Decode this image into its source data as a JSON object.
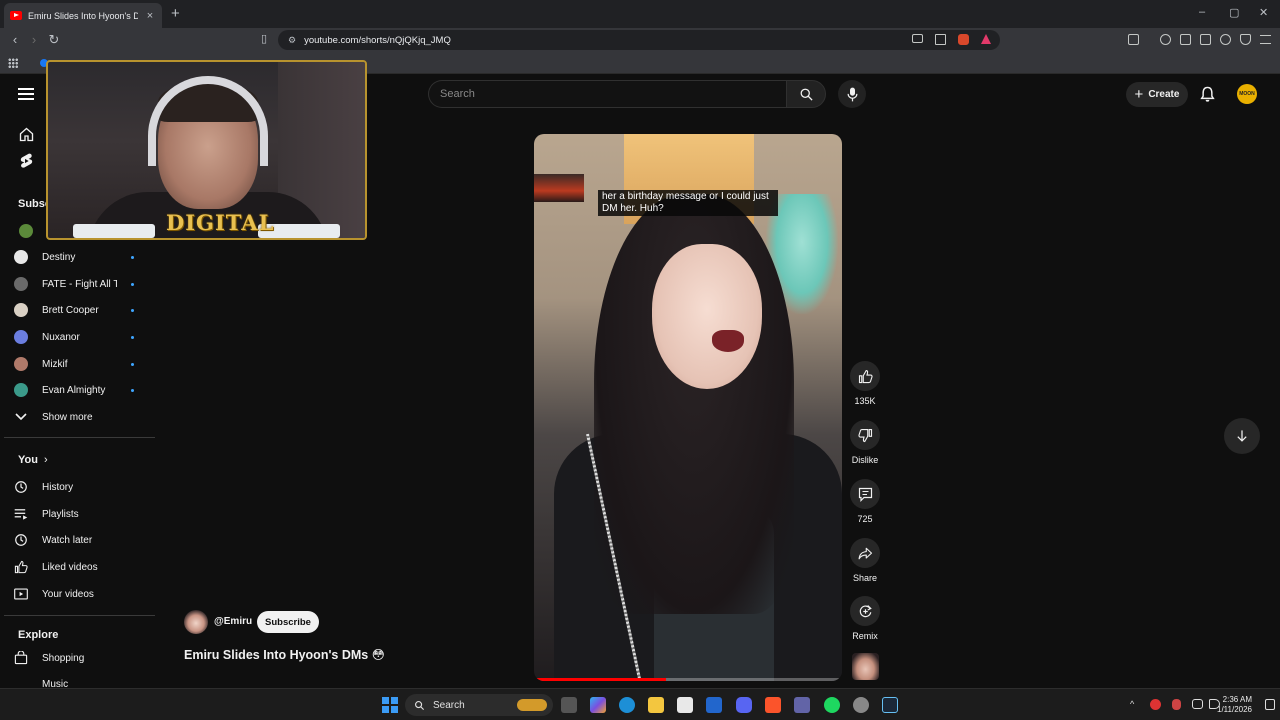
{
  "browser": {
    "tab_title": "Emiru Slides Into Hyoon's DMs",
    "tab_close": "×",
    "new_tab": "+",
    "url": "youtube.com/shorts/nQjQKjq_JMQ",
    "window_controls": [
      "–",
      "▢",
      "✕"
    ]
  },
  "youtube": {
    "search_placeholder": "Search",
    "create_label": "Create",
    "avatar_text": "MOON"
  },
  "sidebar": {
    "subscriptions_heading": "Subsc",
    "channels": [
      {
        "label": "Destiny",
        "color": "#e8e8e8"
      },
      {
        "label": "FATE - Fight All T...",
        "color": "#6a6a6a"
      },
      {
        "label": "Brett Cooper",
        "color": "#d9d0c4"
      },
      {
        "label": "Nuxanor",
        "color": "#6b7ee0"
      },
      {
        "label": "Mizkif",
        "color": "#b07a6a"
      },
      {
        "label": "Evan Almighty",
        "color": "#3b9a8a"
      }
    ],
    "show_more": "Show more",
    "you_heading": "You",
    "you_items": [
      "History",
      "Playlists",
      "Watch later",
      "Liked videos",
      "Your videos"
    ],
    "explore_heading": "Explore",
    "explore_items": [
      "Shopping",
      "Music"
    ]
  },
  "webcam": {
    "logo_text": "DIGITAL"
  },
  "short": {
    "caption": "her a birthday message or I could just DM her. Huh?",
    "progress": 0.43,
    "like_count": "135K",
    "dislike_label": "Dislike",
    "comment_count": "725",
    "share_label": "Share",
    "remix_label": "Remix",
    "channel_handle": "@Emiru",
    "subscribe_label": "Subscribe",
    "title": "Emiru Slides Into Hyoon's DMs 😳"
  },
  "taskbar": {
    "search_label": "Search",
    "time": "2:36 AM",
    "date": "1/11/2026"
  },
  "colors": {
    "background": "#0f0f0f",
    "accent_red": "#ff0000",
    "webcam_frame": "#b8932e"
  }
}
